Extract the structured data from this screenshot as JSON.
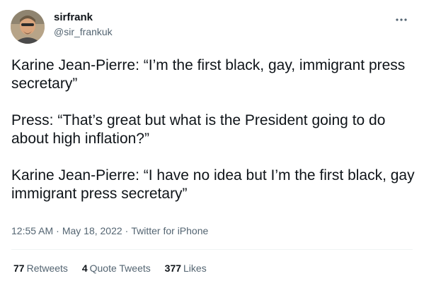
{
  "author": {
    "display_name": "sirfrank",
    "handle": "@sir_frankuk",
    "avatar_icon": "user-avatar"
  },
  "tweet": {
    "paragraphs": [
      "Karine Jean-Pierre: “I’m the first black, gay, immigrant press secretary”",
      "Press: “That’s great but what is the President going to do about high inflation?”",
      "Karine Jean-Pierre: “I have no idea but I’m the first black, gay immigrant press secretary”"
    ],
    "time": "12:55 AM",
    "separator": "·",
    "date": "May 18, 2022",
    "source": "Twitter for iPhone"
  },
  "stats": {
    "retweets_count": "77",
    "retweets_label": "Retweets",
    "quotes_count": "4",
    "quotes_label": "Quote Tweets",
    "likes_count": "377",
    "likes_label": "Likes"
  },
  "more_icon": "more-horizontal-icon",
  "colors": {
    "text": "#0f1419",
    "secondary": "#536471",
    "divider": "#eff3f4"
  }
}
